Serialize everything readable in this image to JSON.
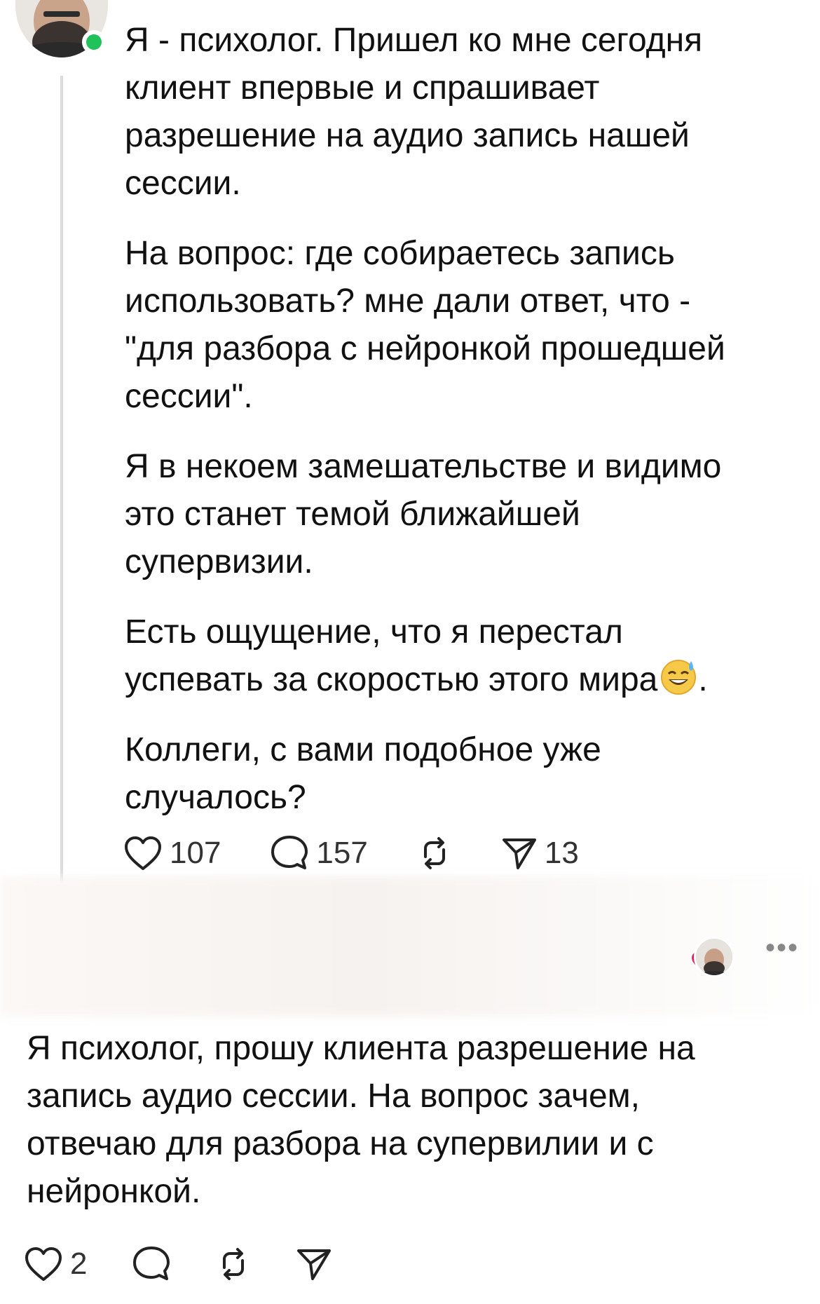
{
  "post": {
    "paragraphs": [
      "Я - психолог. Пришел ко мне сегодня\nклиент впервые и спрашивает\nразрешение на аудио запись нашей\nсессии.",
      "На вопрос: где собираетесь запись\nиспользовать? мне дали ответ, что -\n\"для разбора с нейронкой прошедшей\nсессии\".",
      "Я в некоем замешательстве и видимо\nэто станет темой ближайшей\nсупервизии.",
      "Коллеги, с вами подобное уже\nслучалось?"
    ],
    "para4_before_emoji": "Есть ощущение, что я перестал\nуспевать за скоростью этого мира",
    "para4_after_emoji": ".",
    "likes": "107",
    "comments": "157",
    "shares": "13"
  },
  "reply": {
    "text": "Я психолог, прошу клиента разрешение на\nзапись аудио сессии. На вопрос зачем,\nотвечаю для разбора на супервилии и с\nнейронкой.",
    "likes": "2",
    "more": "•••"
  },
  "icons": {
    "heart": "heart-icon",
    "comment": "comment-icon",
    "repost": "repost-icon",
    "share": "share-icon",
    "emoji": "sweat-smile-emoji"
  },
  "colors": {
    "online": "#22c25b",
    "heart_red": "#e0245e",
    "text": "#111111"
  }
}
